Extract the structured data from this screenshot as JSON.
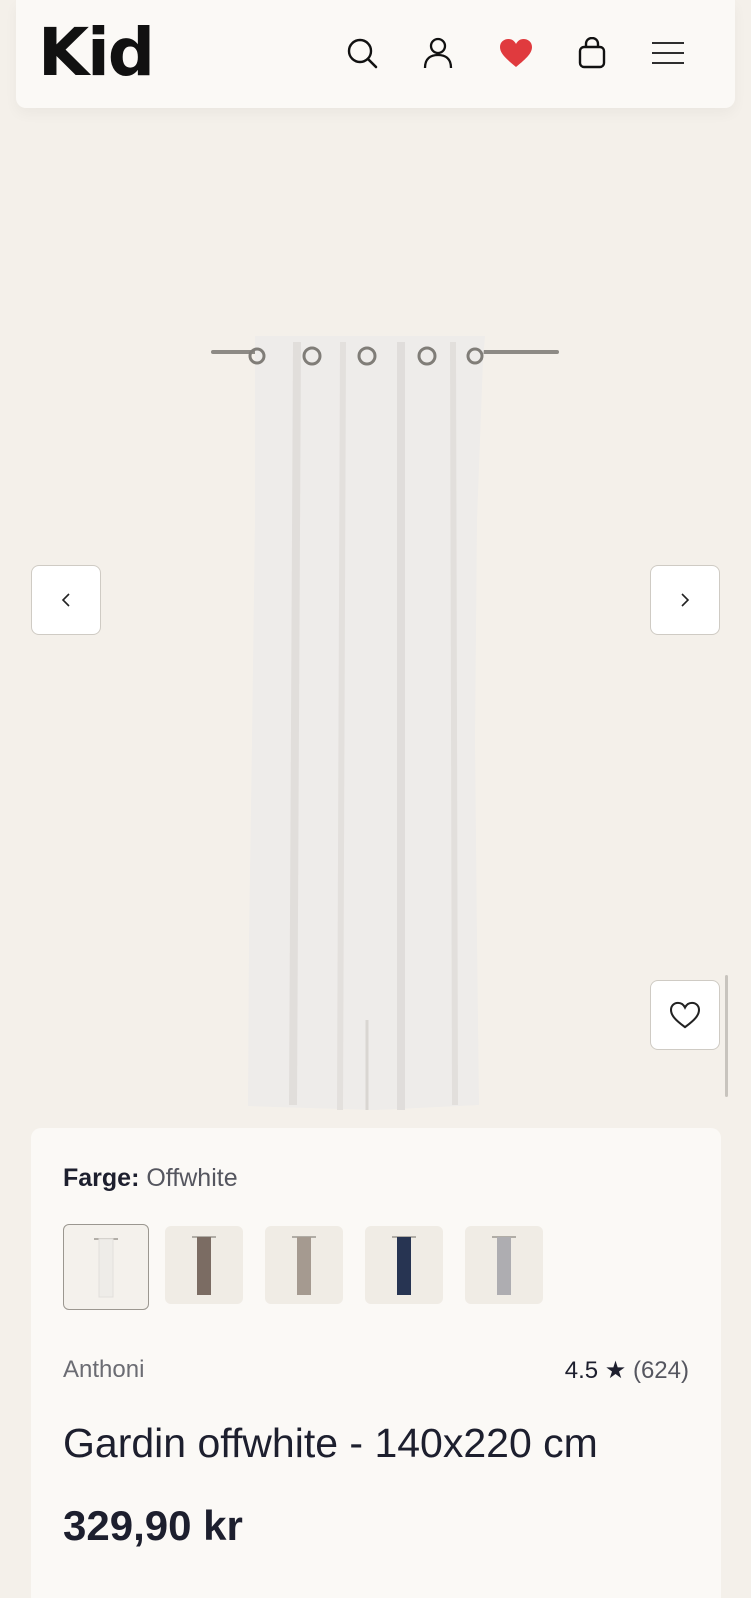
{
  "header": {
    "logo": "Kid",
    "icons": [
      "search-icon",
      "user-icon",
      "heart-filled-icon",
      "bag-icon",
      "menu-icon"
    ],
    "accent_heart_color": "#e03a3e"
  },
  "gallery": {
    "prev_label": "‹",
    "next_label": "›"
  },
  "product": {
    "color_label": "Farge:",
    "color_value": "Offwhite",
    "swatches": [
      {
        "name": "Offwhite",
        "color": "#eeece8"
      },
      {
        "name": "Brown",
        "color": "#7b6c63"
      },
      {
        "name": "Beige",
        "color": "#a59a90"
      },
      {
        "name": "Navy",
        "color": "#273452"
      },
      {
        "name": "Grey",
        "color": "#aeadb1"
      }
    ],
    "brand": "Anthoni",
    "rating": "4.5",
    "rating_star": "★",
    "rating_count": "(624)",
    "title": "Gardin offwhite - 140x220 cm",
    "price": "329,90 kr"
  }
}
